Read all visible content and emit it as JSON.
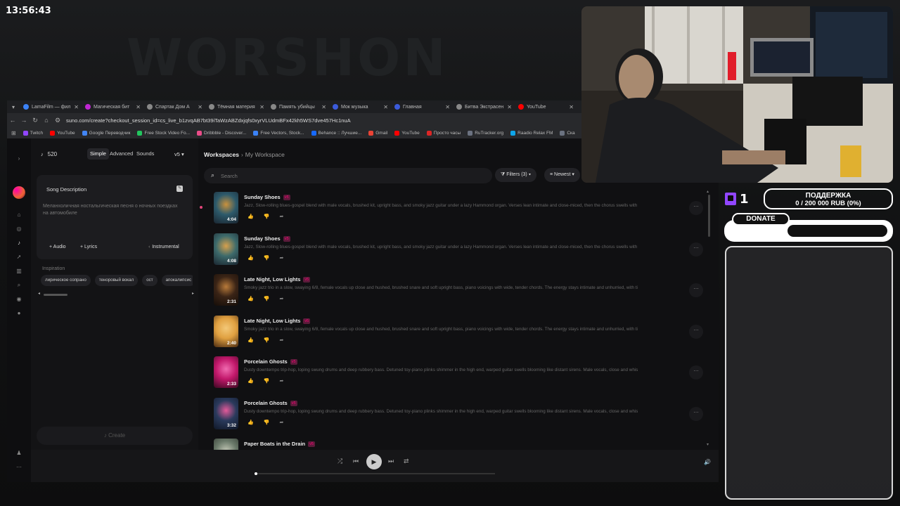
{
  "clock": "13:56:43",
  "background_text": "WORSHON",
  "browser": {
    "tabs": [
      {
        "label": "LamaFilm — фил",
        "color": "#3b82f6"
      },
      {
        "label": "Магическая бит",
        "color": "#c026d3"
      },
      {
        "label": "Спартак Дом А",
        "color": "#888888"
      },
      {
        "label": "Тёмная материя",
        "color": "#888888"
      },
      {
        "label": "Память убийцы",
        "color": "#888888"
      },
      {
        "label": "Мок музыка",
        "color": "#3b5bdb"
      },
      {
        "label": "Главная",
        "color": "#3b5bdb"
      },
      {
        "label": "Битва Экстрасен",
        "color": "#888888"
      },
      {
        "label": "YouTube",
        "color": "#ff0000"
      }
    ],
    "url": "suno.com/create?checkout_session_id=cs_live_b1zvqAB7bt39iTaWzABZdxjqfs0xyrVLUdmBFx42kh5WS7dve457Hc1nuA",
    "bookmarks": [
      {
        "label": "Twitch",
        "color": "#9146ff"
      },
      {
        "label": "YouTube",
        "color": "#ff0000"
      },
      {
        "label": "Google Переводчик",
        "color": "#4285f4"
      },
      {
        "label": "Free Stock Video Fo...",
        "color": "#22c55e"
      },
      {
        "label": "Dribbble - Discover...",
        "color": "#ea4c89"
      },
      {
        "label": "Free Vectors, Stock...",
        "color": "#3b82f6"
      },
      {
        "label": "Behance :: Лучшие...",
        "color": "#1769ff"
      },
      {
        "label": "Gmail",
        "color": "#ea4335"
      },
      {
        "label": "YouTube",
        "color": "#ff0000"
      },
      {
        "label": "Просто часы",
        "color": "#dc2626"
      },
      {
        "label": "RuTracker.org",
        "color": "#6b7280"
      },
      {
        "label": "Raadio Relax FM",
        "color": "#0ea5e9"
      },
      {
        "label": "Ска",
        "color": "#6b7280"
      }
    ]
  },
  "create": {
    "credits": "520",
    "modes": [
      "Simple",
      "Advanced",
      "Sounds"
    ],
    "version": "v5",
    "desc_title": "Song Description",
    "desc_text": "Меланхоличная ностальгическая песня о ночных поездках на автомобиле",
    "audio_label": "Audio",
    "lyrics_label": "Lyrics",
    "instrumental_label": "Instrumental",
    "inspiration_label": "Inspiration",
    "chips": [
      "лирическое сопрано",
      "теноровый вокал",
      "ост",
      "апокалипсис"
    ],
    "create_label": "Create"
  },
  "main": {
    "crumb_root": "Workspaces",
    "crumb_current": "My Workspace",
    "search_placeholder": "Search",
    "filters_label": "Filters (3)",
    "sort_label": "Newest"
  },
  "songs": [
    {
      "title": "Sunday Shoes",
      "badge": "v5",
      "duration": "4:04",
      "desc": "Jazz, Slow-rolling blues-gospel blend with male vocals, brushed kit, upright bass, and smoky jazz guitar under a lazy Hammond organ. Verses lean intimate and close-miced, then the chorus swells with church...",
      "colors": [
        "#2d5a6b",
        "#c9913d",
        "#1a2530"
      ],
      "playing": true
    },
    {
      "title": "Sunday Shoes",
      "badge": "v5",
      "duration": "4:08",
      "desc": "Jazz, Slow-rolling blues-gospel blend with male vocals, brushed kit, upright bass, and smoky jazz guitar under a lazy Hammond organ. Verses lean intimate and close-miced, then the chorus swells with church...",
      "colors": [
        "#3d6a6b",
        "#d6a04d",
        "#1a2530"
      ],
      "playing": false
    },
    {
      "title": "Late Night, Low Lights",
      "badge": "v5",
      "duration": "2:31",
      "desc": "Smoky jazz trio in a slow, swaying 6/8, female vocals up close and hushed, brushed snare and soft upright bass, piano voicings with wide, tender chords. The energy stays intimate and unhurried, with tiny dy...",
      "colors": [
        "#3a2416",
        "#b87a3a",
        "#150d08"
      ],
      "playing": false
    },
    {
      "title": "Late Night, Low Lights",
      "badge": "v5",
      "duration": "2:40",
      "desc": "Smoky jazz trio in a slow, swaying 6/8, female vocals up close and hushed, brushed snare and soft upright bass, piano voicings with wide, tender chords. The energy stays intimate and unhurried, with tiny dy...",
      "colors": [
        "#e0a040",
        "#f3c878",
        "#4a2a10"
      ],
      "playing": false
    },
    {
      "title": "Porcelain Ghosts",
      "badge": "v5",
      "duration": "2:33",
      "desc": "Dusty downtempo trip-hop, loping swung drums and deep rubbery bass. Detuned toy-piano plinks shimmer in the high end, warped guitar swells blooming like distant sirens. Male vocals, close and whisper...",
      "colors": [
        "#c2186b",
        "#f06bb0",
        "#3a0820"
      ],
      "playing": false
    },
    {
      "title": "Porcelain Ghosts",
      "badge": "v5",
      "duration": "3:32",
      "desc": "Dusty downtempo trip-hop, loping swung drums and deep rubbery bass. Detuned toy-piano plinks shimmer in the high end, warped guitar swells blooming like distant sirens. Male vocals, close and whisper...",
      "colors": [
        "#2a3a5c",
        "#e35a9a",
        "#101828"
      ],
      "playing": false
    },
    {
      "title": "Paper Boats in the Drain",
      "badge": "v5",
      "duration": "",
      "desc": "",
      "colors": [
        "#6b7a6a",
        "#c5c9b8",
        "#2a302a"
      ],
      "playing": false
    }
  ],
  "overlay": {
    "viewer_count": "1",
    "goal_title": "ПОДДЕРЖКА",
    "goal_progress": "0 / 200 000 RUB (0%)",
    "goal_fraction": 0,
    "donate_label": "DONATE"
  }
}
